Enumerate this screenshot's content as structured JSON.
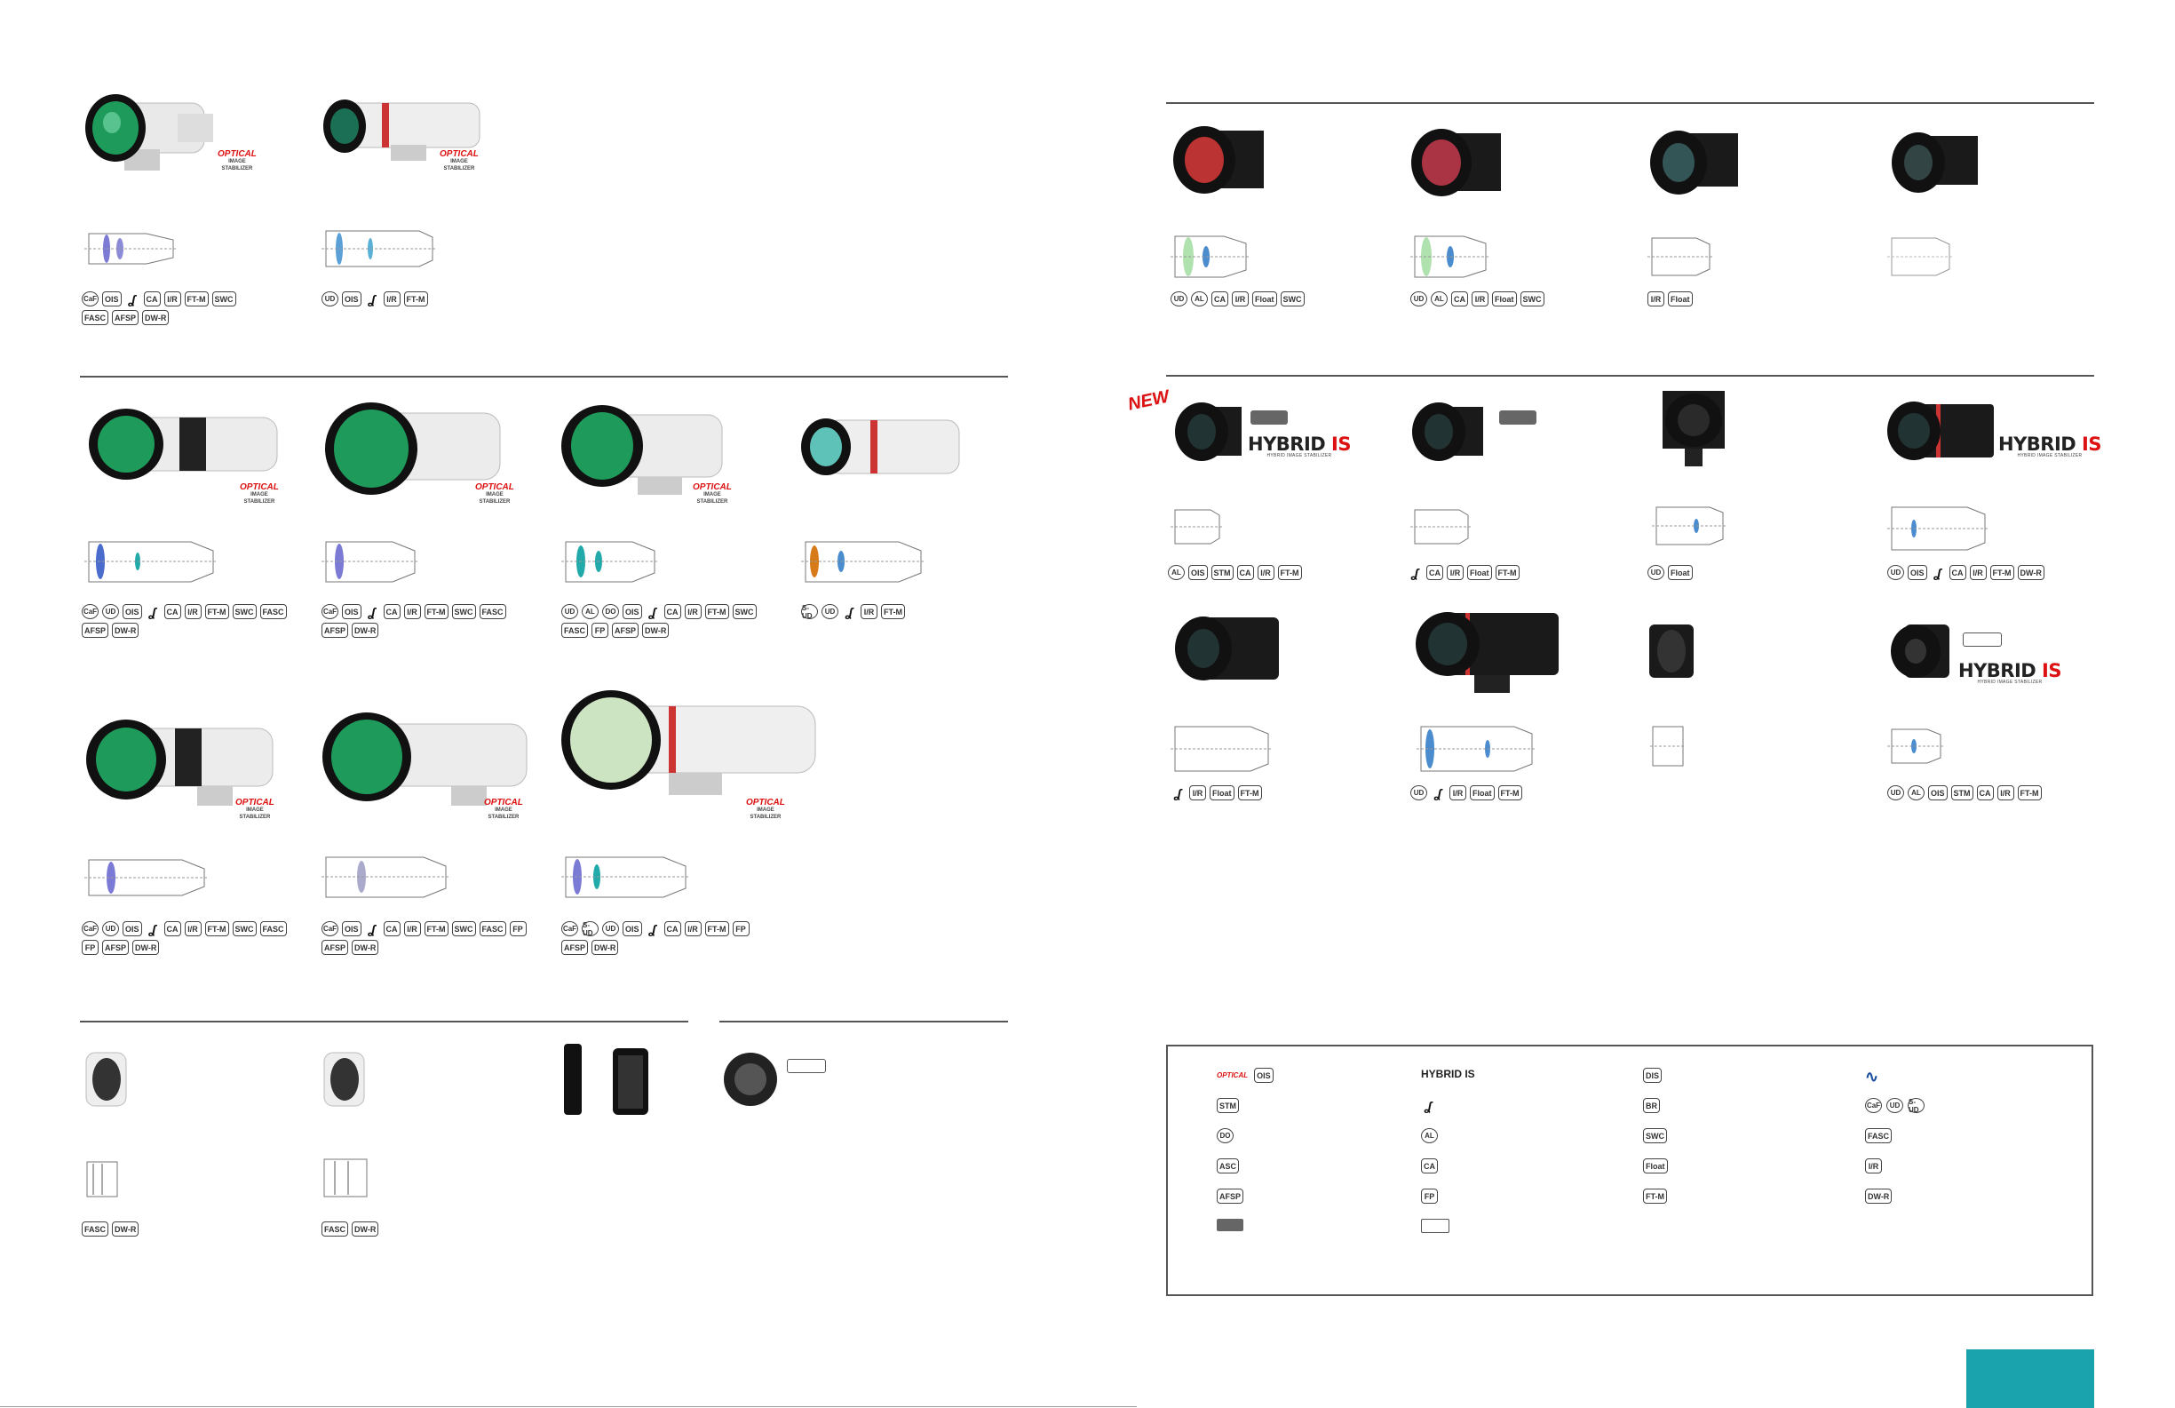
{
  "icons": {
    "row_a1": [
      "CaF",
      "OIS",
      "logo",
      "CA",
      "I/R",
      "FT-M",
      "SWC",
      "FASC",
      "AFSP",
      "DW-R"
    ],
    "row_a2": [
      "UD",
      "OIS",
      "logo",
      "I/R",
      "FT-M"
    ],
    "row_b1": [
      "CaF",
      "UD",
      "OIS",
      "logo",
      "CA",
      "I/R",
      "FT-M",
      "SWC",
      "FASC",
      "AFSP",
      "DW-R"
    ],
    "row_b2": [
      "CaF",
      "OIS",
      "logo",
      "CA",
      "I/R",
      "FT-M",
      "SWC",
      "FASC",
      "AFSP",
      "DW-R"
    ],
    "row_b3": [
      "UD",
      "AL",
      "DO",
      "OIS",
      "logo",
      "CA",
      "I/R",
      "FT-M",
      "SWC",
      "FASC",
      "FP",
      "AFSP",
      "DW-R"
    ],
    "row_b4": [
      "S-UD",
      "UD",
      "logo",
      "I/R",
      "FT-M"
    ],
    "row_c1": [
      "CaF",
      "UD",
      "OIS",
      "logo",
      "CA",
      "I/R",
      "FT-M",
      "SWC",
      "FASC",
      "FP",
      "AFSP",
      "DW-R"
    ],
    "row_c2": [
      "CaF",
      "OIS",
      "logo",
      "CA",
      "I/R",
      "FT-M",
      "SWC",
      "FASC",
      "FP",
      "AFSP",
      "DW-R"
    ],
    "row_c3": [
      "CaF",
      "S-UD",
      "UD",
      "OIS",
      "logo",
      "CA",
      "I/R",
      "FT-M",
      "FP",
      "AFSP",
      "DW-R"
    ],
    "row_d1": [
      "FASC",
      "DW-R"
    ],
    "row_d2": [
      "FASC",
      "DW-R"
    ],
    "row_e1": [
      "UD",
      "AL",
      "CA",
      "I/R",
      "Float",
      "SWC"
    ],
    "row_e2": [
      "UD",
      "AL",
      "CA",
      "I/R",
      "Float",
      "SWC"
    ],
    "row_e3": [
      "I/R",
      "Float"
    ],
    "row_f1": [
      "AL",
      "OIS",
      "STM",
      "CA",
      "I/R",
      "FT-M"
    ],
    "row_f2": [
      "logo",
      "CA",
      "I/R",
      "Float",
      "FT-M"
    ],
    "row_f3": [
      "UD",
      "Float"
    ],
    "row_f4": [
      "UD",
      "OIS",
      "logo",
      "CA",
      "I/R",
      "FT-M",
      "DW-R"
    ],
    "row_g1": [
      "logo",
      "I/R",
      "Float",
      "FT-M"
    ],
    "row_g2": [
      "UD",
      "logo",
      "I/R",
      "Float",
      "FT-M"
    ],
    "row_g4": [
      "UD",
      "AL",
      "OIS",
      "STM",
      "CA",
      "I/R",
      "FT-M"
    ]
  },
  "badges": {
    "optical": "OPTICAL",
    "optical_sub1": "IMAGE",
    "optical_sub2": "STABILIZER",
    "hybrid_word1": "HYBRID",
    "hybrid_word2": "IS",
    "hybrid_sub": "HYBRID IMAGE STABILIZER",
    "new": "NEW"
  },
  "legend": {
    "col1": [
      "OIS",
      "STM",
      "DO",
      "ASC",
      "AFSP",
      ""
    ],
    "col2": [
      "HYBRID IS",
      "logo",
      "AL",
      "CA",
      "FP",
      ""
    ],
    "col3": [
      "DIS",
      "BR",
      "SWC",
      "Float",
      "FT-M"
    ],
    "col4": [
      "SUBWAVELENGTH",
      "CaF UD S-UD",
      "FASC",
      "I/R",
      "DW-R"
    ]
  },
  "colors": {
    "teal": "#1aa3ad",
    "red": "#dd1111"
  }
}
